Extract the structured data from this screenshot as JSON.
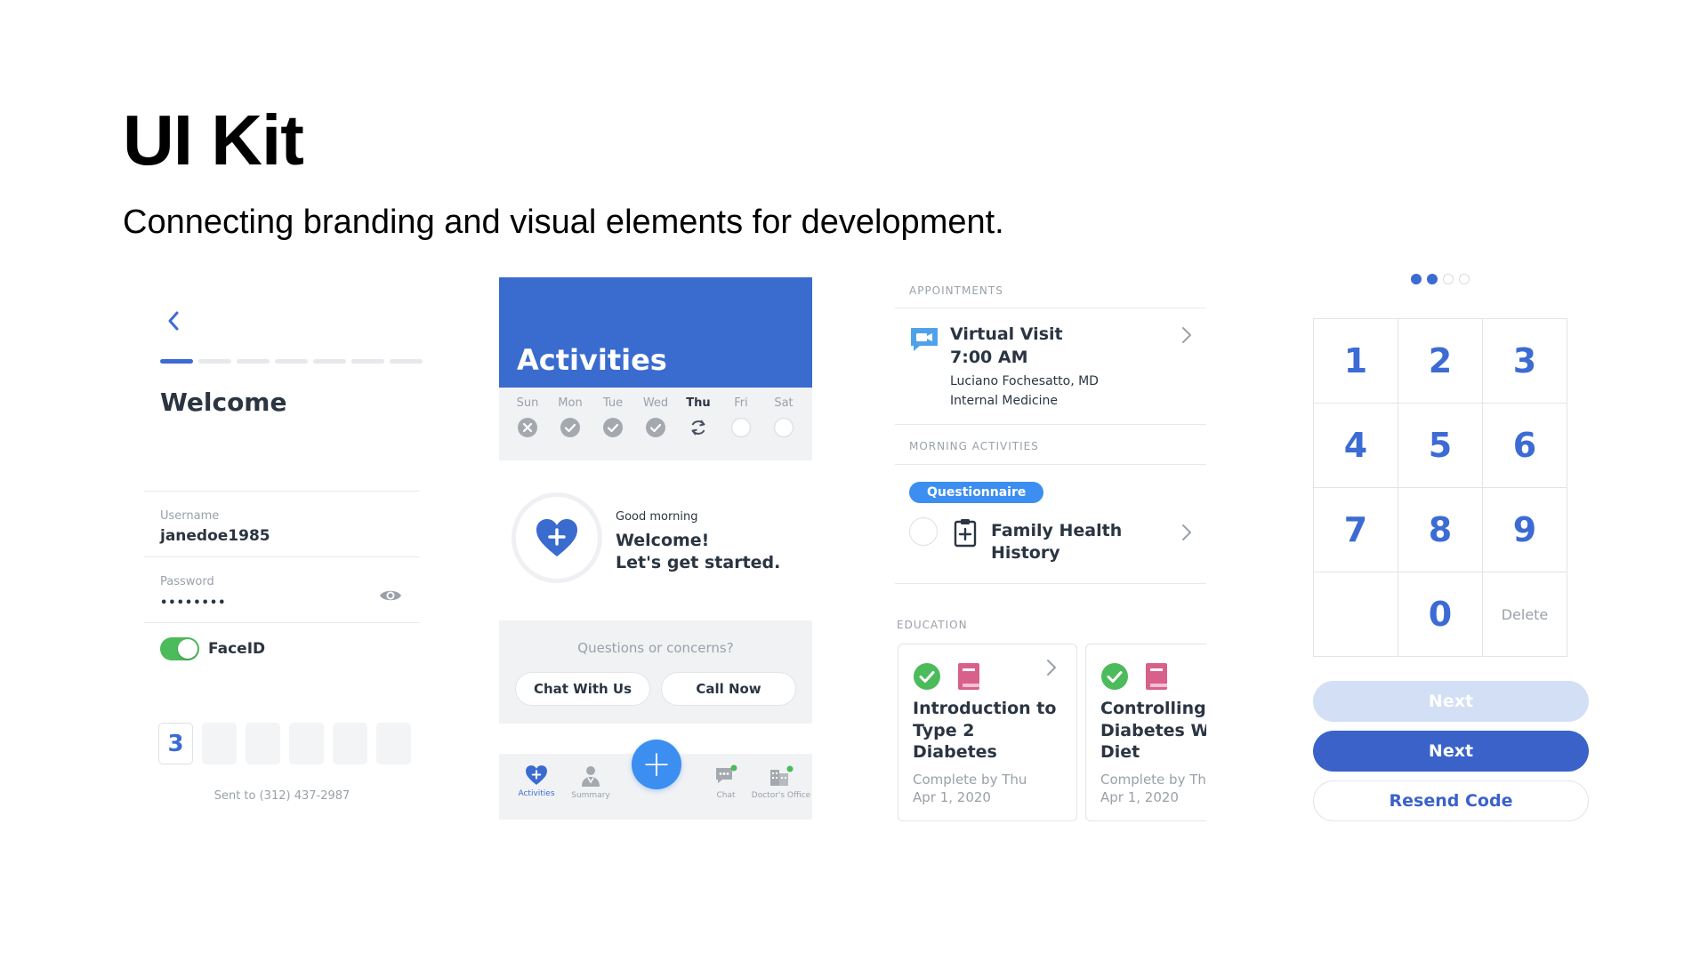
{
  "slide": {
    "title": "UI Kit",
    "subtitle": "Connecting branding and visual elements for development."
  },
  "login": {
    "welcome": "Welcome",
    "progress_step": 1,
    "progress_total": 7,
    "username_label": "Username",
    "username_value": "janedoe1985",
    "password_label": "Password",
    "password_value": "••••••••",
    "faceid_label": "FaceID",
    "faceid_enabled": true,
    "code_digits": [
      "3",
      "",
      "",
      "",
      "",
      ""
    ],
    "sent_to": "Sent to (312) 437-2987"
  },
  "activities": {
    "title": "Activities",
    "days": [
      {
        "label": "Sun",
        "status": "missed"
      },
      {
        "label": "Mon",
        "status": "done"
      },
      {
        "label": "Tue",
        "status": "done"
      },
      {
        "label": "Wed",
        "status": "done"
      },
      {
        "label": "Thu",
        "status": "in-progress"
      },
      {
        "label": "Fri",
        "status": "empty"
      },
      {
        "label": "Sat",
        "status": "empty"
      }
    ],
    "greeting_small": "Good morning",
    "greeting_line1": "Welcome!",
    "greeting_line2": "Let's get started.",
    "questions_label": "Questions or concerns?",
    "chat_button": "Chat With Us",
    "call_button": "Call Now",
    "tabs": [
      {
        "label": "Activities",
        "icon": "heart-plus-icon",
        "active": true
      },
      {
        "label": "Summary",
        "icon": "doctor-icon",
        "active": false
      },
      {
        "label": "Chat",
        "icon": "chat-bubble-icon",
        "active": false
      },
      {
        "label": "Doctor's Office",
        "icon": "building-icon",
        "active": false
      }
    ],
    "fab_label": "+"
  },
  "appointments": {
    "section_appointments": "APPOINTMENTS",
    "visit_title": "Virtual Visit",
    "visit_time": "7:00 AM",
    "visit_doctor": "Luciano Fochesatto, MD",
    "visit_specialty": "Internal Medicine",
    "section_morning": "MORNING ACTIVITIES",
    "badge": "Questionnaire",
    "activity_line1": "Family Health",
    "activity_line2": "History",
    "section_education": "EDUCATION",
    "education": [
      {
        "line1": "Introduction to",
        "line2": "Type 2",
        "line3": "Diabetes",
        "due1": "Complete by Thu",
        "due2": "Apr 1, 2020"
      },
      {
        "line1": "Controlling",
        "line2": "Diabetes With",
        "line3": "Diet",
        "due1": "Complete by Thu",
        "due2": "Apr 1, 2020"
      }
    ]
  },
  "keypad": {
    "dots": [
      true,
      true,
      false,
      false
    ],
    "keys": [
      "1",
      "2",
      "3",
      "4",
      "5",
      "6",
      "7",
      "8",
      "9",
      "",
      "0",
      "Delete"
    ],
    "next_disabled": "Next",
    "next": "Next",
    "resend": "Resend Code"
  },
  "colors": {
    "brand_blue": "#3a6bce",
    "accent_blue": "#3c8ef0",
    "success_green": "#4cbb5c",
    "book_pink": "#d9608b"
  }
}
